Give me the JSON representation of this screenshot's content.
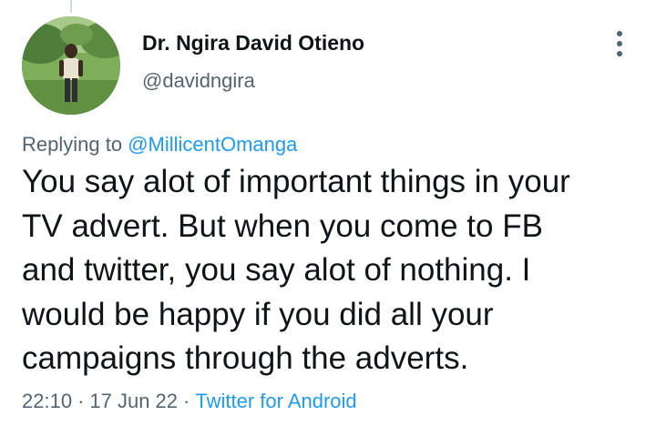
{
  "tweet": {
    "author": {
      "name": "Dr. Ngira David Otieno",
      "handle": "@davidngira"
    },
    "reply_to": {
      "prefix": "Replying to",
      "mention": "@MillicentOmanga"
    },
    "text_lines": [
      "You say alot of important things in your",
      "TV advert. But when you come to FB",
      "and twitter, you say alot of nothing. I",
      "would be happy if you did all your",
      "campaigns through the adverts."
    ],
    "meta": {
      "time": "22:10",
      "separator": "·",
      "date": "17 Jun 22",
      "source": "Twitter for Android"
    }
  },
  "icons": {
    "more": "more-vertical-icon"
  },
  "colors": {
    "text": "#0f1419",
    "secondary": "#536471",
    "link": "#1d9bf0"
  }
}
